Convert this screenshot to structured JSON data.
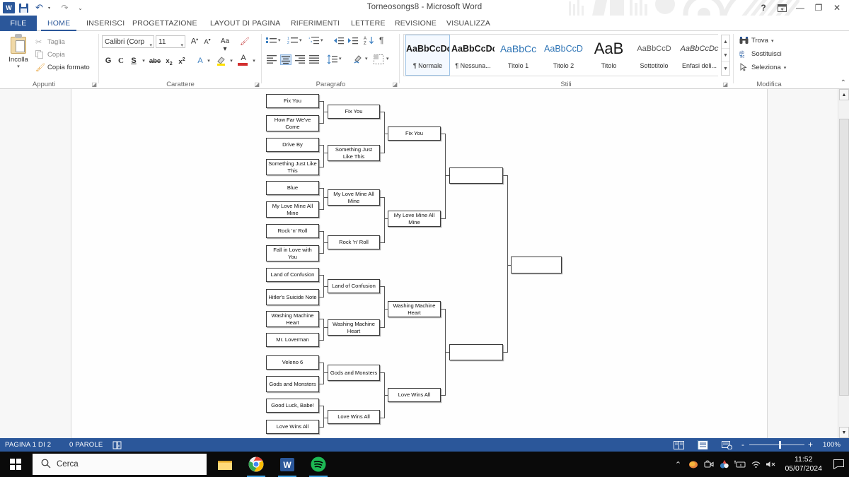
{
  "window": {
    "title": "Torneosongs8 - Microsoft Word",
    "quick_access": [
      "word-logo",
      "save-icon",
      "undo-icon",
      "redo-icon",
      "customize-qat-icon"
    ],
    "controls": {
      "help": "?",
      "ribbon_display": "ribbon-options-icon",
      "minimize": "—",
      "restore": "❐",
      "close": "✕"
    }
  },
  "tabs": [
    {
      "label": "FILE",
      "active": false,
      "file": true
    },
    {
      "label": "HOME",
      "active": true
    },
    {
      "label": "INSERISCI",
      "active": false
    },
    {
      "label": "PROGETTAZIONE",
      "active": false
    },
    {
      "label": "LAYOUT DI PAGINA",
      "active": false
    },
    {
      "label": "RIFERIMENTI",
      "active": false
    },
    {
      "label": "LETTERE",
      "active": false
    },
    {
      "label": "REVISIONE",
      "active": false
    },
    {
      "label": "VISUALIZZA",
      "active": false
    }
  ],
  "ribbon": {
    "clipboard": {
      "group_label": "Appunti",
      "paste_label": "Incolla",
      "items": [
        {
          "label": "Taglia",
          "icon": "scissors-icon"
        },
        {
          "label": "Copia",
          "icon": "copy-icon"
        },
        {
          "label": "Copia formato",
          "icon": "format-painter-icon"
        }
      ]
    },
    "font": {
      "group_label": "Carattere",
      "font_name": "Calibri (Corp",
      "font_size": "11",
      "buttons": {
        "grow": "A",
        "shrink": "A",
        "change_case": "Aa",
        "clear_format": "clear-formatting-icon",
        "bold": "G",
        "italic": "C",
        "underline": "S",
        "strikethrough": "abc",
        "subscript": "x₂",
        "superscript": "x²",
        "text_effects": "A",
        "highlight": "highlight-icon",
        "font_color": "A"
      }
    },
    "paragraph": {
      "group_label": "Paragrafo",
      "buttons": [
        "bullets-icon",
        "numbering-icon",
        "multilevel-list-icon",
        "decrease-indent-icon",
        "increase-indent-icon",
        "sort-icon",
        "show-marks-icon",
        "align-left-icon",
        "align-center-icon",
        "align-right-icon",
        "justify-icon",
        "line-spacing-icon",
        "shading-icon",
        "borders-icon"
      ],
      "active_button": "align-center-icon"
    },
    "styles": {
      "group_label": "Stili",
      "items": [
        {
          "preview": "AaBbCcDc",
          "name": "¶ Normale",
          "selected": true,
          "color": "#1a1a1a",
          "size": "12.5px",
          "weight": "bold"
        },
        {
          "preview": "AaBbCcDc",
          "name": "¶ Nessuna...",
          "selected": false,
          "color": "#1a1a1a",
          "size": "12.5px",
          "weight": "bold"
        },
        {
          "preview": "AaBbCc",
          "name": "Titolo 1",
          "selected": false,
          "color": "#2e74b5",
          "size": "14px",
          "weight": "normal"
        },
        {
          "preview": "AaBbCcD",
          "name": "Titolo 2",
          "selected": false,
          "color": "#2e74b5",
          "size": "12.5px",
          "weight": "normal"
        },
        {
          "preview": "AaB",
          "name": "Titolo",
          "selected": false,
          "color": "#1a1a1a",
          "size": "21px",
          "weight": "normal"
        },
        {
          "preview": "AaBbCcD",
          "name": "Sottotitolo",
          "selected": false,
          "color": "#595959",
          "size": "11px",
          "weight": "normal"
        },
        {
          "preview": "AaBbCcDc",
          "name": "Enfasi deli...",
          "selected": false,
          "color": "#404040",
          "size": "11px",
          "weight": "normal",
          "italic": true
        }
      ]
    },
    "editing": {
      "group_label": "Modifica",
      "items": [
        {
          "label": "Trova",
          "icon": "binoculars-icon",
          "caret": true
        },
        {
          "label": "Sostituisci",
          "icon": "replace-icon",
          "caret": false
        },
        {
          "label": "Seleziona",
          "icon": "select-cursor-icon",
          "caret": true
        }
      ]
    },
    "collapse": "collapse-ribbon-icon"
  },
  "document": {
    "zoom_level": "100%",
    "bracket": {
      "round1": [
        "Fix You",
        "How Far We've Come",
        "Drive By",
        "Something Just Like This",
        "Blue",
        "My Love Mine All Mine",
        "Rock 'n' Roll",
        "Fall in Love with You",
        "Land of Confusion",
        "Hitler's Suicide Note",
        "Washing Machine Heart",
        "Mr. Loverman",
        "Veleno 6",
        "Gods and Monsters",
        "Good Luck, Babe!",
        "Love Wins All"
      ],
      "round2": [
        "Fix You",
        "Something Just Like This",
        "My Love Mine All Mine",
        "Rock 'n' Roll",
        "Land of Confusion",
        "Washing Machine Heart",
        "Gods and Monsters",
        "Love Wins All"
      ],
      "round3": [
        "Fix You",
        "My Love Mine All Mine",
        "Washing Machine Heart",
        "Love Wins All"
      ],
      "round4": [
        "",
        ""
      ],
      "final": [
        ""
      ]
    }
  },
  "statusbar": {
    "page_info": "PAGINA 1 DI 2",
    "word_count": "0 PAROLE",
    "proofing_icon": "proofing-errors-icon",
    "view_icons": [
      "read-mode-icon",
      "print-layout-icon",
      "web-layout-icon"
    ],
    "zoom_out": "-",
    "zoom_in": "+",
    "zoom_level": "100%"
  },
  "taskbar": {
    "start": "windows-start-icon",
    "search_placeholder": "Cerca",
    "search_icon": "search-icon",
    "apps": [
      {
        "name": "file-explorer-icon",
        "active": false
      },
      {
        "name": "google-chrome-icon",
        "active": true
      },
      {
        "name": "microsoft-word-icon",
        "active": true
      },
      {
        "name": "spotify-icon",
        "active": true
      }
    ],
    "tray": [
      "show-hidden-icons-icon",
      "firefox-icon",
      "camera-icon",
      "app-icon",
      "keyboard-icon",
      "network-icon",
      "volume-muted-icon"
    ],
    "time": "11:52",
    "date": "05/07/2024",
    "notifications": "action-center-icon"
  }
}
